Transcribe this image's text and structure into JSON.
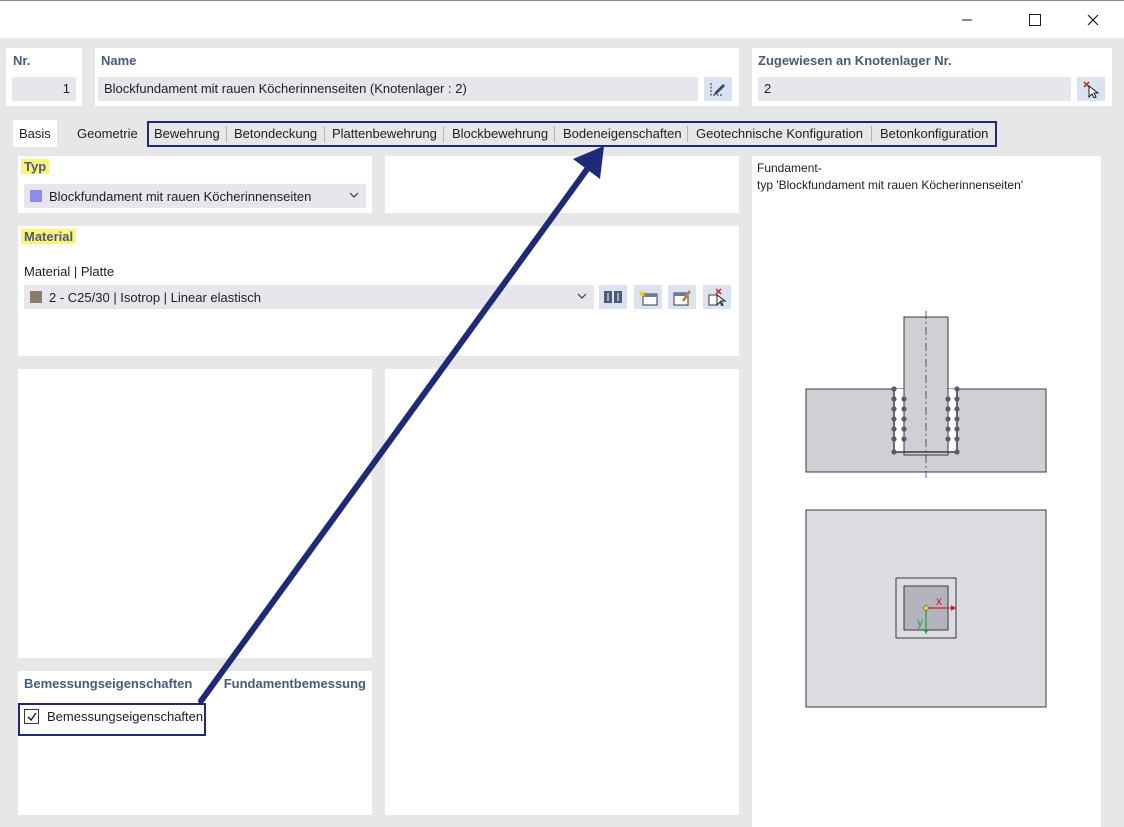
{
  "window": {
    "minimize_label": "—",
    "maximize_label": "☐",
    "close_label": "✕"
  },
  "header": {
    "nr_label": "Nr.",
    "nr_value": "1",
    "name_label": "Name",
    "name_value": "Blockfundament mit rauen Köcherinnenseiten (Knotenlager : 2)",
    "assigned_label": "Zugewiesen an Knotenlager Nr.",
    "assigned_value": "2"
  },
  "tabs": [
    {
      "label": "Basis"
    },
    {
      "label": "Geometrie"
    },
    {
      "label": "Bewehrung"
    },
    {
      "label": "Betondeckung"
    },
    {
      "label": "Plattenbewehrung"
    },
    {
      "label": "Blockbewehrung"
    },
    {
      "label": "Bodeneigenschaften"
    },
    {
      "label": "Geotechnische Konfiguration"
    },
    {
      "label": "Betonkonfiguration"
    }
  ],
  "typ": {
    "header": "Typ",
    "selected": "Blockfundament mit rauen Köcherinnenseiten",
    "swatch_color": "#8c8cf0"
  },
  "material": {
    "header": "Material",
    "sub_label": "Material | Platte",
    "selected": "2 - C25/30 | Isotrop | Linear elastisch",
    "swatch_color": "#8b7b6b"
  },
  "design": {
    "header_left": "Bemessungseigenschaften",
    "header_right": "Fundamentbemessung",
    "checkbox_label": "Bemessungseigenschaften",
    "checked": true
  },
  "preview": {
    "caption_line1": "Fundament-",
    "caption_line2": "typ 'Blockfundament mit rauen Köcherinnenseiten'",
    "axis_x": "x",
    "axis_y": "y"
  },
  "colors": {
    "accent_navy": "#1e2a78",
    "highlight_yellow": "#fbf37a",
    "header_text": "#4a5a7a"
  }
}
